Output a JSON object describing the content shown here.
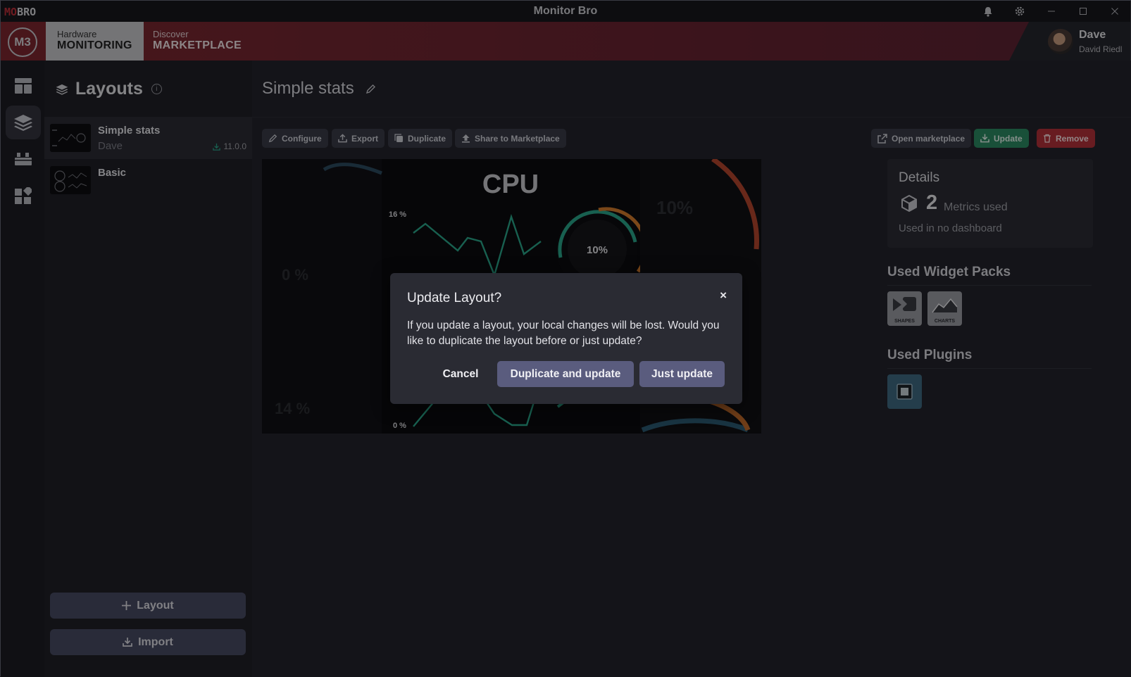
{
  "window": {
    "logo_mo": "MO",
    "logo_bro": "BRO",
    "title": "Monitor Bro",
    "icons": [
      "bell-icon",
      "gear-icon",
      "minimize-icon",
      "maximize-icon",
      "close-icon"
    ]
  },
  "header": {
    "brand": "M3",
    "tabs": [
      {
        "small": "Hardware",
        "large": "MONITORING",
        "active": true
      },
      {
        "small": "Discover",
        "large": "MARKETPLACE",
        "active": false
      }
    ],
    "user": {
      "name": "Dave",
      "full_name": "David Riedl"
    }
  },
  "rail": {
    "items": [
      "dashboard-icon",
      "layers-icon",
      "widgets-icon",
      "apps-icon"
    ],
    "active_index": 1
  },
  "layouts_panel": {
    "title": "Layouts",
    "items": [
      {
        "name": "Simple stats",
        "author": "Dave",
        "version": "11.0.0",
        "active": true
      },
      {
        "name": "Basic",
        "author": "",
        "version": "",
        "active": false
      }
    ],
    "add_button": "Layout",
    "import_button": "Import"
  },
  "main": {
    "title": "Simple stats",
    "toolbar_left": [
      "Configure",
      "Export",
      "Duplicate",
      "Share to Marketplace"
    ],
    "toolbar_right": [
      "Open marketplace",
      "Update",
      "Remove"
    ],
    "preview": {
      "heading": "CPU",
      "axis_top": "16 %",
      "axis_bottom": "0 %",
      "gauge_value": "10%",
      "left_top": "0 %",
      "left_bottom": "14 %",
      "right_value": "10%"
    },
    "details": {
      "title": "Details",
      "metrics_count": "2",
      "metrics_label": "Metrics used",
      "dashboard_usage": "Used in no dashboard"
    },
    "widget_packs": {
      "title": "Used Widget Packs",
      "items": [
        "SHAPES",
        "CHARTS"
      ]
    },
    "plugins": {
      "title": "Used Plugins"
    }
  },
  "dialog": {
    "title": "Update Layout?",
    "close_symbol": "×",
    "message": "If you update a layout, your local changes will be lost. Would you like to duplicate the layout before or just update?",
    "cancel": "Cancel",
    "duplicate_update": "Duplicate and update",
    "just_update": "Just update"
  },
  "colors": {
    "header_red": "#7d2730",
    "accent_green": "#2c8a63",
    "danger_red": "#b3313a",
    "dialog_button": "#5a5c7e",
    "chart_line": "#2aa58a",
    "gauge_orange": "#d27a2c"
  }
}
